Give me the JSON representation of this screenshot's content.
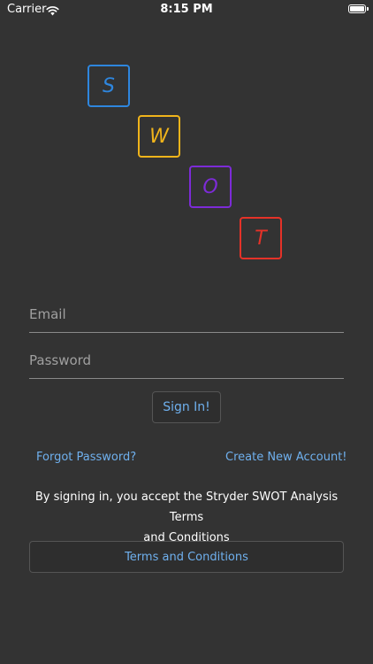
{
  "status_bar": {
    "carrier": "Carrier",
    "time": "8:15 PM"
  },
  "logo": {
    "tiles": [
      {
        "letter": "S",
        "color": "#2e86de"
      },
      {
        "letter": "W",
        "color": "#f0b41b"
      },
      {
        "letter": "O",
        "color": "#7d2bd8"
      },
      {
        "letter": "T",
        "color": "#e53228"
      }
    ]
  },
  "form": {
    "email_placeholder": "Email",
    "password_placeholder": "Password",
    "signin_label": "Sign In!"
  },
  "links": {
    "forgot_password": "Forgot Password?",
    "create_account": "Create New Account!"
  },
  "terms": {
    "notice_line1": "By signing in, you accept the Stryder SWOT Analysis Terms",
    "notice_line2": "and Conditions",
    "button_label": "Terms and Conditions"
  },
  "colors": {
    "background": "#333333",
    "link": "#6fb0ee"
  }
}
